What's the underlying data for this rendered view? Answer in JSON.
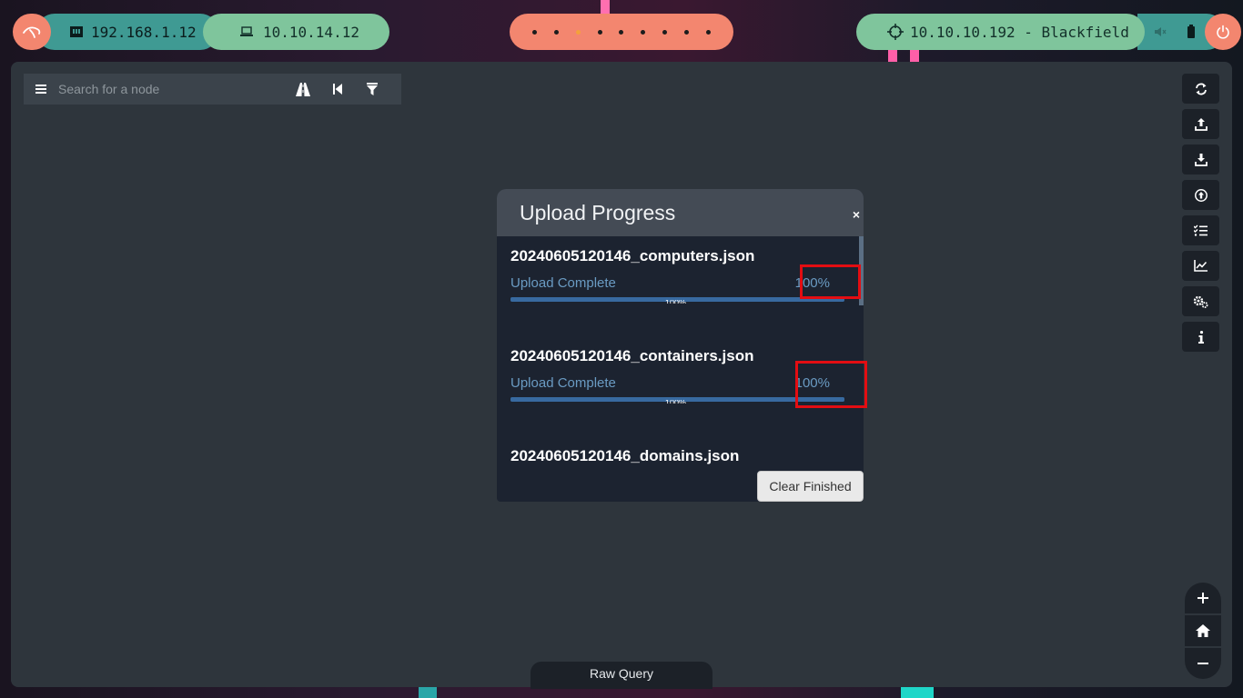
{
  "topbar": {
    "local_ip": "192.168.1.12",
    "vpn_ip": "10.10.14.12",
    "target": "10.10.10.192 - Blackfield",
    "workspaces": [
      {
        "active": false
      },
      {
        "active": false
      },
      {
        "active": true
      },
      {
        "active": false
      },
      {
        "active": false
      },
      {
        "active": false
      },
      {
        "active": false
      },
      {
        "active": false
      },
      {
        "active": false
      }
    ]
  },
  "search": {
    "placeholder": "Search for a node"
  },
  "side_tools": [
    "refresh-icon",
    "upload-icon",
    "download-icon",
    "import-icon",
    "queries-icon",
    "graph-stats-icon",
    "settings-icon",
    "info-icon"
  ],
  "zoom": [
    "zoom-in-icon",
    "home-icon",
    "zoom-out-icon"
  ],
  "raw_query": {
    "label": "Raw Query"
  },
  "modal": {
    "title": "Upload Progress",
    "close": "×",
    "items": [
      {
        "file": "20240605120146_computers.json",
        "status": "Upload Complete",
        "percent": "100%",
        "progress": 1.0,
        "bar_label": "100%"
      },
      {
        "file": "20240605120146_containers.json",
        "status": "Upload Complete",
        "percent": "100%",
        "progress": 1.0,
        "bar_label": "100%"
      },
      {
        "file": "20240605120146_domains.json"
      }
    ],
    "clear_button": "Clear Finished"
  },
  "colors": {
    "accent_orange": "#f3866f",
    "accent_green": "#7fc59c",
    "accent_teal": "#3f9a93",
    "highlight_red": "#e30d12"
  }
}
